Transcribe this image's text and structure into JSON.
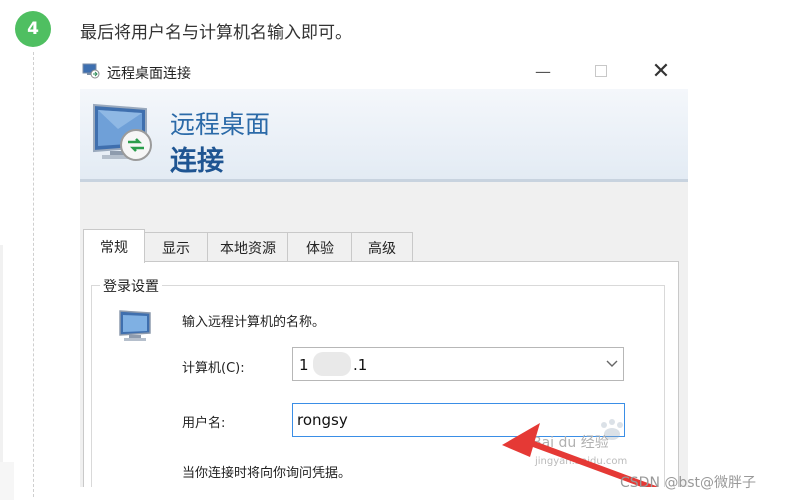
{
  "step": {
    "number": "4",
    "text": "最后将用户名与计算机名输入即可。"
  },
  "window": {
    "title": "远程桌面连接",
    "banner_line1": "远程桌面",
    "banner_line2": "连接",
    "tabs": [
      "常规",
      "显示",
      "本地资源",
      "体验",
      "高级"
    ],
    "active_tab": "常规",
    "group_title": "登录设置",
    "prompt": "输入远程计算机的名称。",
    "computer_label": "计算机(C):",
    "computer_value_prefix": "1",
    "computer_value_suffix": ".1",
    "username_label": "用户名:",
    "username_value": "rongsy",
    "hint": "当你连接时将向你询问凭据。"
  },
  "watermark": {
    "brand": "Bai du 经验",
    "url": "jingyan.baidu.com"
  },
  "footer": "CSDN @bst@微胖子",
  "colors": {
    "step_green": "#4fbf61",
    "banner_blue": "#2b6aa8",
    "arrow_red": "#e53935",
    "input_focus": "#3a8ee6"
  }
}
